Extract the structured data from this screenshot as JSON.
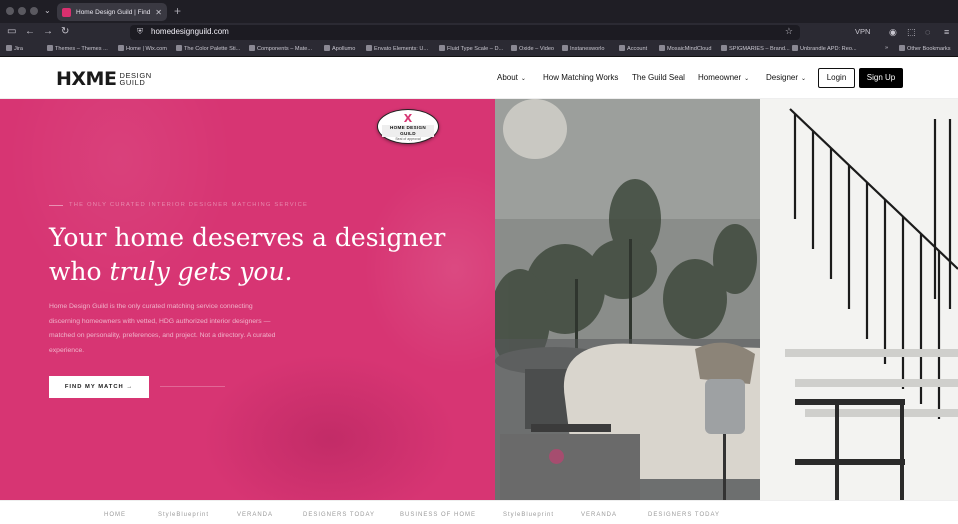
{
  "browser": {
    "tab": {
      "title": "Home Design Guild | Find Top In"
    },
    "url": "homedesignguild.com",
    "vpn_label": "VPN",
    "bookmarks": [
      "Jira",
      "Themes – Themes ...",
      "Home | Wix.com",
      "The Color Palette Sti...",
      "Components – Mate...",
      "Apollumo",
      "Envato Elements: U...",
      "Fluid Type Scale – D...",
      "Oxide – Video",
      "Instanesworlo",
      "Account",
      "MosaicMindCloud",
      "SPIGMARIES – Brand...",
      "Unbrandle APD: Reo...",
      "Other Bookmarks"
    ]
  },
  "site": {
    "logo": {
      "mark": "HXME",
      "sub_line1": "DESIGN",
      "sub_line2": "GUILD"
    },
    "nav": {
      "about": "About",
      "how": "How Matching Works",
      "seal": "The Guild Seal",
      "homeowner": "Homeowner",
      "designer": "Designer",
      "login": "Login",
      "signup": "Sign Up"
    },
    "hero": {
      "eyebrow": "THE ONLY CURATED INTERIOR DESIGNER MATCHING SERVICE",
      "headline_line1": "Your home deserves a designer",
      "headline_line2_plain": "who ",
      "headline_line2_italic": "truly gets you.",
      "body": "Home Design Guild is the only curated matching service connecting discerning homeowners with vetted, HDG authorized interior designers — matched on personality, preferences, and project. Not a directory. A curated experience.",
      "cta": "FIND MY MATCH →"
    },
    "seal_badge": {
      "mark": "X",
      "title": "HOME DESIGN GUILD",
      "sub": "Seal of approval"
    },
    "press": [
      "HOME",
      "StyleBlueprint",
      "VERANDA",
      "DESIGNERS TODAY",
      "BUSINESS OF HOME",
      "StyleBlueprint",
      "VERANDA",
      "DESIGNERS TODAY"
    ]
  },
  "colors": {
    "brand_pink": "#d73573",
    "ink": "#111111"
  }
}
